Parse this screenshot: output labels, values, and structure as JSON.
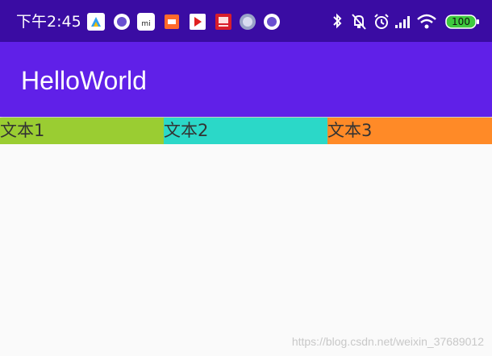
{
  "status_bar": {
    "time": "下午2:45",
    "battery_level": "100",
    "notification_icons": [
      "app-icon-1",
      "app-icon-2",
      "mi-store-icon",
      "mi-icon",
      "video-icon",
      "tv-icon",
      "vpn-icon",
      "app-icon-3"
    ],
    "system_icons": [
      "bluetooth-icon",
      "mute-icon",
      "alarm-icon",
      "signal-icon",
      "wifi-icon",
      "battery-icon"
    ]
  },
  "app_bar": {
    "title": "HelloWorld",
    "color": "#6020e8"
  },
  "tabs": [
    {
      "label": "文本1",
      "color": "#9acd32"
    },
    {
      "label": "文本2",
      "color": "#2bd8c8"
    },
    {
      "label": "文本3",
      "color": "#ff8a27"
    }
  ],
  "watermark": "https://blog.csdn.net/weixin_37689012"
}
